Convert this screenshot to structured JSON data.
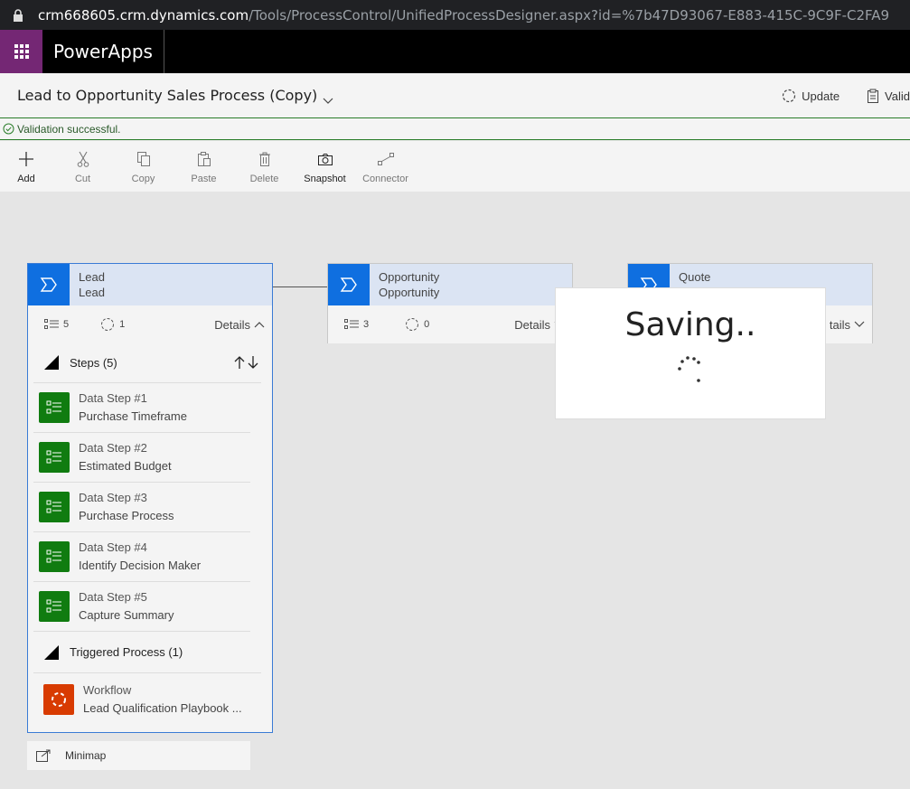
{
  "browser": {
    "url_host": "crm668605.crm.dynamics.com",
    "url_path": "/Tools/ProcessControl/UnifiedProcessDesigner.aspx?id=%7b47D93067-E883-415C-9C9F-C2FA9"
  },
  "app": {
    "brand": "PowerApps"
  },
  "header": {
    "title": "Lead to Opportunity Sales Process (Copy)",
    "actions": [
      {
        "label": "Update"
      },
      {
        "label": "Valid"
      }
    ]
  },
  "notification": {
    "text": "Validation successful."
  },
  "toolbar": {
    "items": [
      {
        "label": "Add"
      },
      {
        "label": "Cut"
      },
      {
        "label": "Copy"
      },
      {
        "label": "Paste"
      },
      {
        "label": "Delete"
      },
      {
        "label": "Snapshot"
      },
      {
        "label": "Connector"
      }
    ]
  },
  "stages": [
    {
      "name": "Lead",
      "entity": "Lead",
      "steps": "5",
      "triggers": "1",
      "details": "Details"
    },
    {
      "name": "Opportunity",
      "entity": "Opportunity",
      "steps": "3",
      "triggers": "0",
      "details": "Details"
    },
    {
      "name": "Quote",
      "details": "tails"
    }
  ],
  "steps_panel": {
    "steps_header": "Steps (5)",
    "steps": [
      {
        "title": "Data Step #1",
        "sub": "Purchase Timeframe"
      },
      {
        "title": "Data Step #2",
        "sub": "Estimated Budget"
      },
      {
        "title": "Data Step #3",
        "sub": "Purchase Process"
      },
      {
        "title": "Data Step #4",
        "sub": "Identify Decision Maker"
      },
      {
        "title": "Data Step #5",
        "sub": "Capture Summary"
      }
    ],
    "triggered_header": "Triggered Process (1)",
    "workflow": {
      "title": "Workflow",
      "sub": "Lead Qualification Playbook ..."
    }
  },
  "minimap": {
    "label": "Minimap"
  },
  "saving": {
    "text": "Saving.."
  }
}
